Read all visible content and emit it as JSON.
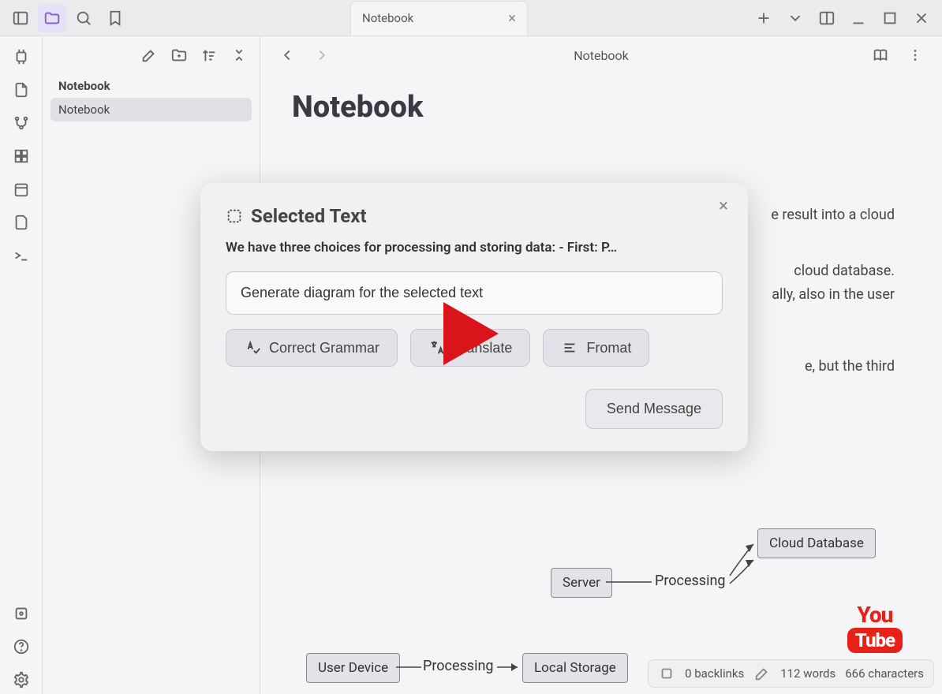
{
  "titlebar": {
    "tab_label": "Notebook"
  },
  "sidebar": {
    "items": [
      {
        "label": "Notebook",
        "bold": true,
        "selected": false
      },
      {
        "label": "Notebook",
        "bold": false,
        "selected": true
      }
    ]
  },
  "toolbar": {
    "breadcrumb": "Notebook"
  },
  "document": {
    "title": "Notebook",
    "body_snippet_1": "e result into a cloud",
    "body_snippet_2": "cloud database.",
    "body_snippet_3": "ally, also in the user",
    "body_snippet_4": "e, but the third"
  },
  "modal": {
    "title": "Selected Text",
    "selected_text": "We have three choices for processing and storing data: - First: P…",
    "input_value": "Generate diagram for the selected text",
    "suggestions": [
      {
        "label": "Correct Grammar",
        "icon": "spellcheck-icon"
      },
      {
        "label": "Translate",
        "icon": "translate-icon"
      },
      {
        "label": "Fromat",
        "icon": "format-icon"
      }
    ],
    "send_label": "Send Message"
  },
  "diagram": {
    "nodes": {
      "cloud_db": "Cloud Database",
      "server": "Server",
      "processing1": "Processing",
      "user_device": "User Device",
      "processing2": "Processing",
      "local_storage": "Local Storage"
    }
  },
  "youtube": {
    "you": "You",
    "tube": "Tube"
  },
  "status": {
    "backlinks": "0 backlinks",
    "words": "112 words",
    "characters": "666 characters"
  }
}
